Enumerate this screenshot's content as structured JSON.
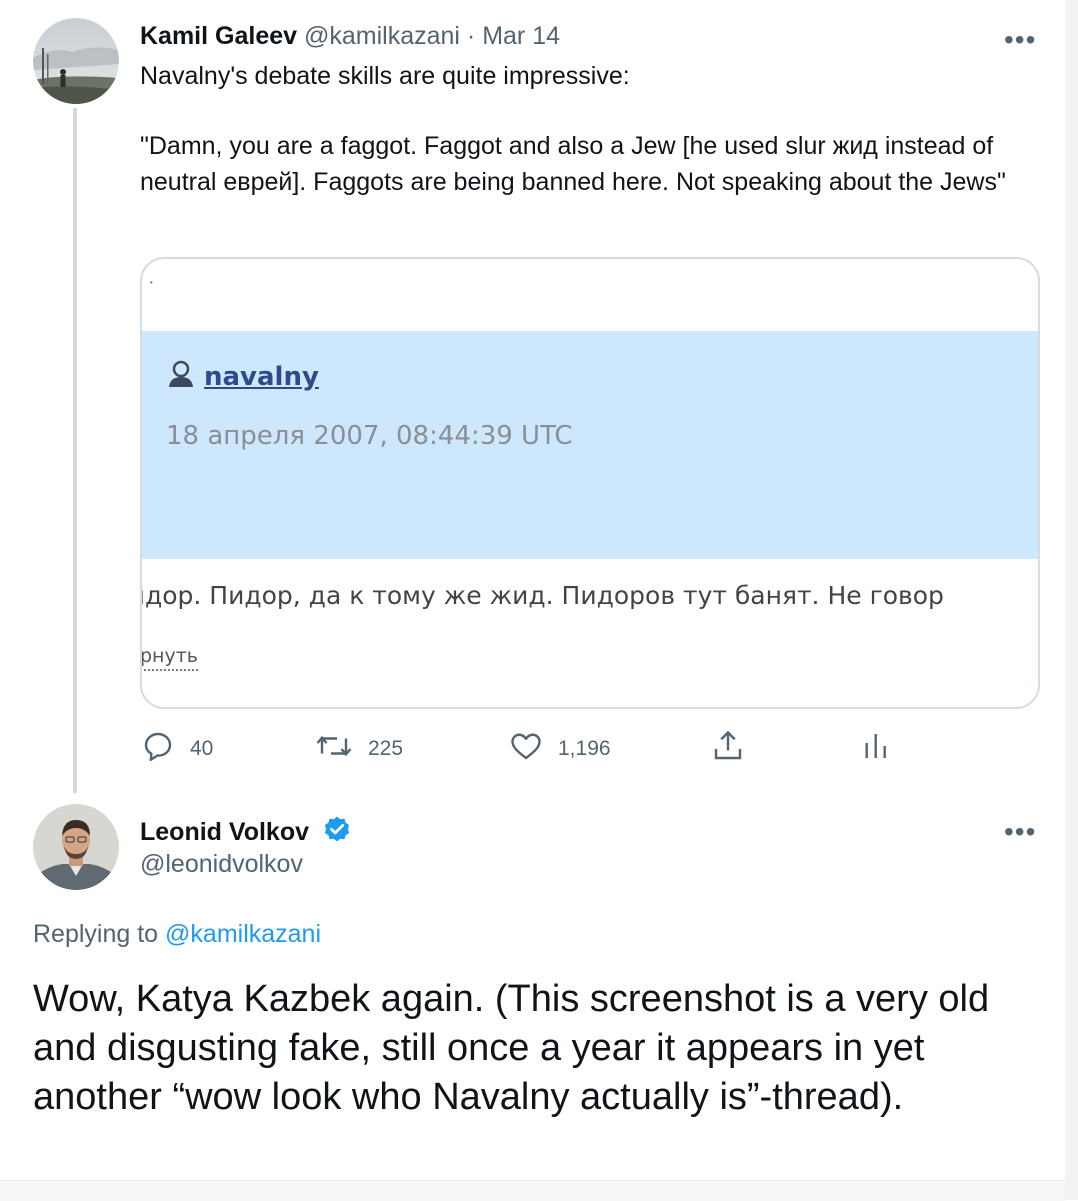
{
  "tweet": {
    "author_name": "Kamil Galeev",
    "author_handle": "@kamilkazani",
    "separator": "·",
    "date": "Mar 14",
    "more_label": "•••",
    "text_line1": "Navalny's debate skills are quite impressive:",
    "text_quote": "\"Damn, you are a faggot. Faggot and also a Jew [he used slur жид instead of neutral еврей]. Faggots are being banned here. Not speaking about the Jews\"",
    "media": {
      "dot": "·",
      "username": "navalny",
      "date": "18 апреля 2007, 08:44:39 UTC",
      "text": "ıдор. Пидор, да к тому же жид. Пидоров тут банят. Не говор",
      "link": "рнуть",
      "band_color": "#cde8fd"
    },
    "actions": {
      "replies": "40",
      "retweets": "225",
      "likes": "1,196",
      "reply_icon": "reply-icon",
      "retweet_icon": "retweet-icon",
      "like_icon": "heart-icon",
      "share_icon": "share-icon",
      "analytics_icon": "analytics-icon"
    }
  },
  "reply": {
    "author_name": "Leonid Volkov",
    "author_handle": "@leonidvolkov",
    "verified": true,
    "more_label": "•••",
    "replying_prefix": "Replying to",
    "replying_handle": "@kamilkazani",
    "text": "Wow, Katya Kazbek again. (This screenshot is a very old and disgusting fake, still once a year it appears in yet another “wow look who Navalny actually is”-thread)."
  },
  "colors": {
    "accent": "#1d9bf0",
    "muted": "#536471",
    "thread_line": "#cfd9de"
  }
}
